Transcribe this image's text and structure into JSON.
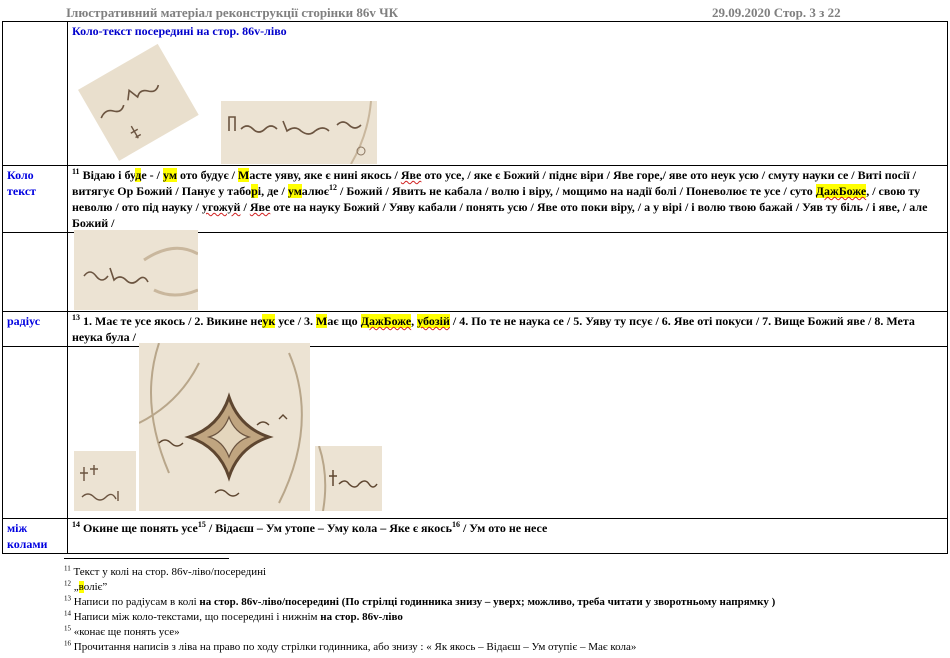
{
  "header": {
    "left": "Ілюстративний матеріал  реконструкції сторінки 86v ЧК",
    "right": "29.09.2020  Стор. 3 з 22"
  },
  "row1": {
    "title": "Коло-текст посередині на стор. 86v-ліво"
  },
  "row2": {
    "label": "Коло текст",
    "sup": "11",
    "parts": [
      " Відаю і бу",
      "д",
      "е - / ",
      "ум",
      " ото будує / ",
      "М",
      "асте уяву, яке є нині якось / ",
      "Яве",
      " ото усе, / яке є Божий / піднє віри / Яве горе,/ яве ото неук усю / смуту науки се / Виті посії / витягує Ор Божий / Панує у табо",
      "р",
      "і, де / ",
      "ум",
      "алює",
      "12",
      " / Божий / Явить не кабала / волю і віру, / мощимо на надії болі / Поневолює те усе / суто ",
      "ДажБоже",
      ", / свою ту неволю / ото під науку / ",
      "угожуй",
      " / ",
      "Яве",
      " оте на науку Божий / Уяву кабали / понять усю / Яве ото поки віру, / а у вірі / і волю твою бажай / Уяв ту біль / і яве, / але Божий /"
    ]
  },
  "row4": {
    "label": "радіус",
    "sup": "13",
    "parts": [
      " 1. Має те усе якось / 2. Викине не",
      "ук",
      " усе / 3. ",
      "М",
      "ає що ",
      "ДажБоже",
      ", ",
      "убозій",
      " / 4. По те не наука се / 5. Уяву ту псує / 6. Яве оті покуси / 7. Вище Божий яве / 8. Мета неука була /"
    ]
  },
  "row6": {
    "label": "між колами",
    "sup": "14",
    "part1": " Окине ще понять усе",
    "sup2": "15",
    "part2": "  /  Відаєш – Ум утопе – Уму кола – Яке є якось",
    "sup3": "16",
    "part3": " / Ум ото не несе"
  },
  "footnotes": [
    {
      "num": "11",
      "text": " Текст у колі на стор. 86v-ліво/посередині"
    },
    {
      "num": "12",
      "pre": " „",
      "hl": "в",
      "post": "оліє”"
    },
    {
      "num": "13",
      "text": " Написи по радіусам в колі ",
      "bold": "на стор. 86v-ліво/посередині (По стрілці годинника знизу – уверх; можливо, треба читати у зворотньому напрямку )"
    },
    {
      "num": "14",
      "text": " Написи між коло-текстами, що посередині і нижнім ",
      "bold": "на стор. 86v-ліво"
    },
    {
      "num": "15",
      "text": " «конає ще понять усе»"
    },
    {
      "num": "16",
      "text": " Прочитання написів з ліва на право по ходу стрілки годинника, або знизу : « Як якось – Відаєш – Ум отупіє – Має кола»"
    }
  ],
  "icons": [
    "manuscript-fragment-image"
  ]
}
